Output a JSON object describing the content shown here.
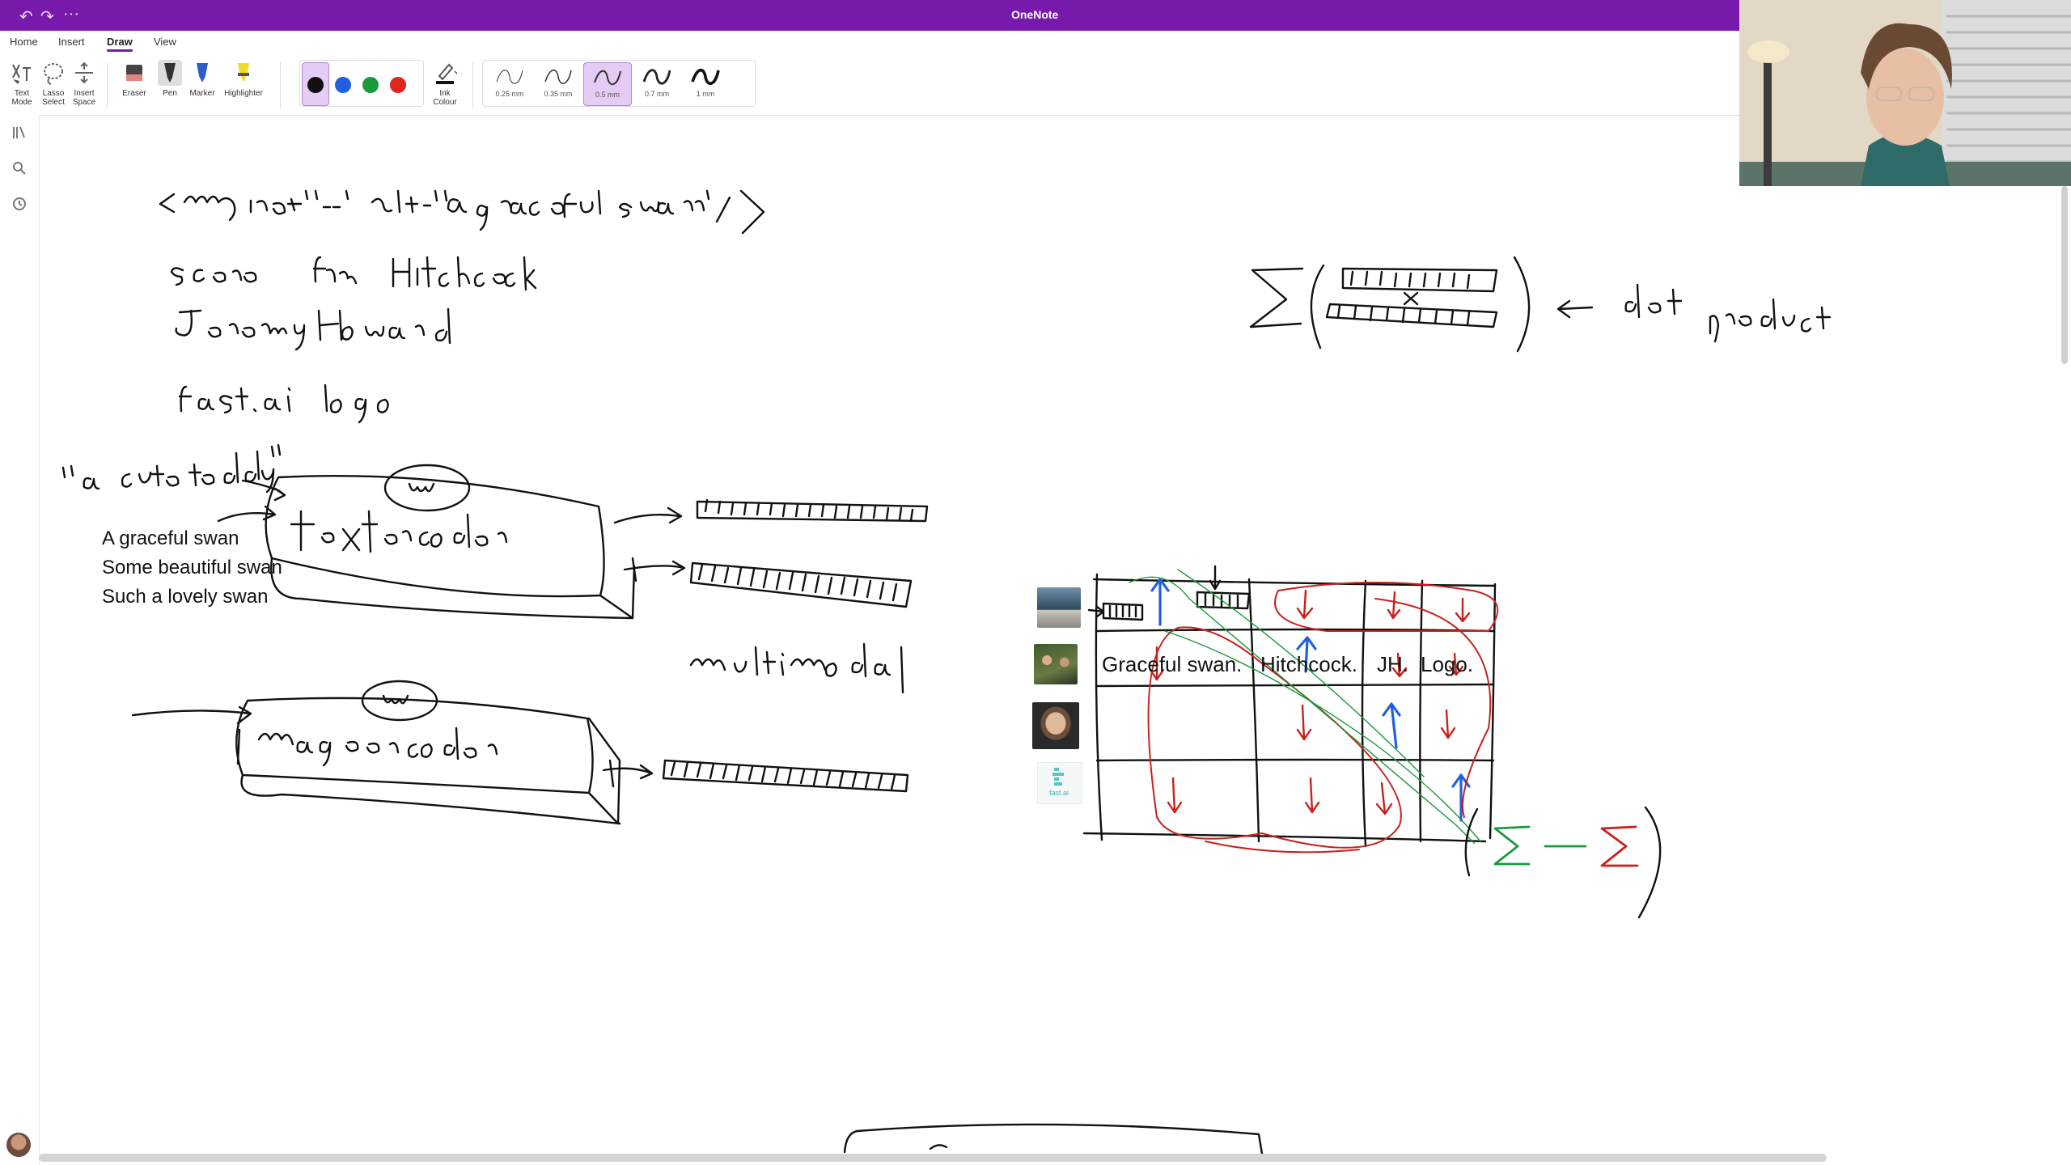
{
  "window": {
    "title": "OneNote",
    "quick_access": [
      "undo-icon",
      "redo-icon",
      "more-icon"
    ],
    "quick_access_more": "···"
  },
  "tabs": [
    {
      "label": "Home",
      "active": false
    },
    {
      "label": "Insert",
      "active": false
    },
    {
      "label": "Draw",
      "active": true
    },
    {
      "label": "View",
      "active": false
    }
  ],
  "ribbon": {
    "text_mode": "Text Mode",
    "text_mode_l1": "Text",
    "text_mode_l2": "Mode",
    "lasso_l1": "Lasso",
    "lasso_l2": "Select",
    "insert_space_l1": "Insert",
    "insert_space_l2": "Space",
    "eraser": "Eraser",
    "pen": "Pen",
    "marker": "Marker",
    "highlighter": "Highlighter",
    "ink_colour_l1": "Ink",
    "ink_colour_l2": "Colour",
    "colors": [
      {
        "name": "black",
        "hex": "#111111",
        "selected": true
      },
      {
        "name": "blue",
        "hex": "#1f5fe0",
        "selected": false
      },
      {
        "name": "green",
        "hex": "#1a9a3c",
        "selected": false
      },
      {
        "name": "red",
        "hex": "#e0271f",
        "selected": false
      }
    ],
    "thickness": [
      {
        "label": "0.25 mm",
        "selected": false
      },
      {
        "label": "0.35 mm",
        "selected": false
      },
      {
        "label": "0.5 mm",
        "selected": true
      },
      {
        "label": "0.7 mm",
        "selected": false
      },
      {
        "label": "1 mm",
        "selected": false
      }
    ]
  },
  "left_rail": [
    "notebooks-icon",
    "search-icon",
    "recent-icon"
  ],
  "page": {
    "typed_captions": [
      "A graceful swan",
      "Some beautiful swan",
      "Such a lovely swan"
    ],
    "matrix_headers": [
      "Graceful swan.",
      "Hitchcock.",
      "JH.",
      "Logo."
    ],
    "logo_thumb_text": "fast.ai"
  },
  "theme": {
    "accent": "#7719aa",
    "ink_black": "#111111",
    "ink_blue": "#1f5fe0",
    "ink_red": "#c8201a",
    "ink_green": "#1a9a3c"
  }
}
